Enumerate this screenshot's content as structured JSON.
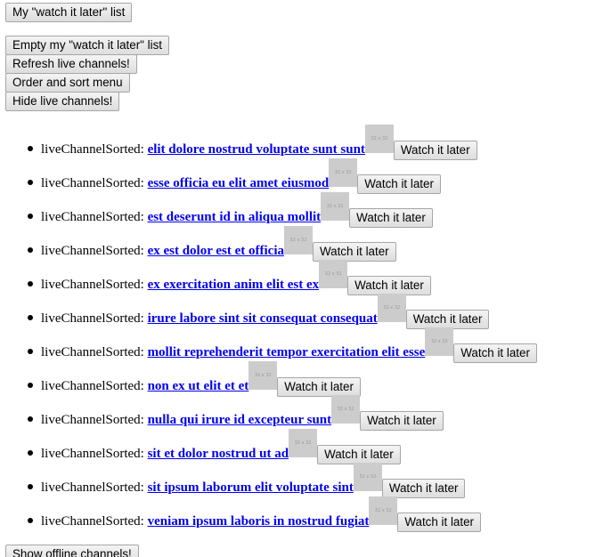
{
  "controls": {
    "watch_list_label": "My \"watch it later\" list",
    "empty_list_label": "Empty my \"watch it later\" list",
    "refresh_label": "Refresh live channels!",
    "order_label": "Order and sort menu",
    "hide_label": "Hide live channels!",
    "show_offline_label": "Show offline channels!"
  },
  "channels": [
    {
      "prefix": "liveChannelSorted:",
      "name": "elit dolore nostrud voluptate sunt sunt",
      "thumb": "32 x 32",
      "button": "Watch it later"
    },
    {
      "prefix": "liveChannelSorted:",
      "name": "esse officia eu elit amet eiusmod",
      "thumb": "32 x 32",
      "button": "Watch it later"
    },
    {
      "prefix": "liveChannelSorted:",
      "name": "est deserunt id in aliqua mollit",
      "thumb": "32 x 32",
      "button": "Watch it later"
    },
    {
      "prefix": "liveChannelSorted:",
      "name": "ex est dolor est et officia",
      "thumb": "32 x 32",
      "button": "Watch it later"
    },
    {
      "prefix": "liveChannelSorted:",
      "name": "ex exercitation anim elit est ex",
      "thumb": "32 x 32",
      "button": "Watch it later"
    },
    {
      "prefix": "liveChannelSorted:",
      "name": "irure labore sint sit consequat consequat",
      "thumb": "32 x 32",
      "button": "Watch it later"
    },
    {
      "prefix": "liveChannelSorted:",
      "name": "mollit reprehenderit tempor exercitation elit esse",
      "thumb": "32 x 32",
      "button": "Watch it later"
    },
    {
      "prefix": "liveChannelSorted:",
      "name": "non ex ut elit et et",
      "thumb": "32 x 32",
      "button": "Watch it later"
    },
    {
      "prefix": "liveChannelSorted:",
      "name": "nulla qui irure id excepteur sunt",
      "thumb": "32 x 32",
      "button": "Watch it later"
    },
    {
      "prefix": "liveChannelSorted:",
      "name": "sit et dolor nostrud ut ad",
      "thumb": "32 x 32",
      "button": "Watch it later"
    },
    {
      "prefix": "liveChannelSorted:",
      "name": "sit ipsum laborum elit voluptate sint",
      "thumb": "32 x 32",
      "button": "Watch it later"
    },
    {
      "prefix": "liveChannelSorted:",
      "name": "veniam ipsum laboris in nostrud fugiat",
      "thumb": "32 x 32",
      "button": "Watch it later"
    }
  ]
}
